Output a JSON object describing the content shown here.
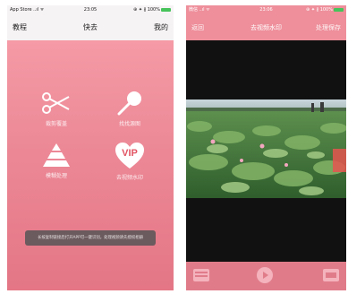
{
  "left": {
    "status": {
      "carrier": "App Store ..ıl ᯤ",
      "time": "23:05",
      "battery": "⊕ ✦ ∦ 100%"
    },
    "nav": {
      "left": "教程",
      "title": "快去",
      "right": "我的"
    },
    "tools": [
      {
        "label": "裁剪覆盖",
        "icon": "scissors-icon"
      },
      {
        "label": "找找源图",
        "icon": "magnifier-icon"
      },
      {
        "label": "模糊处理",
        "icon": "pyramid-icon"
      },
      {
        "label": "去视频水印",
        "icon": "vip-heart-icon"
      }
    ],
    "toast": "长按复制链接后打开APP可一键识别，处理视频请先授权相册"
  },
  "right": {
    "status": {
      "carrier": "微信 ..ıl ᯤ",
      "time": "23:06",
      "battery": "⊕ ✦ ∦ 100%"
    },
    "nav": {
      "left": "返回",
      "title": "去视频水印",
      "right": "处理保存"
    }
  },
  "colors": {
    "pink_top": "#f59aa6",
    "pink_bottom": "#e47685",
    "toast_bg": "#6b5a5e",
    "player_bg": "#111111",
    "controls_bg": "#e07c8a",
    "battery": "#46c35a"
  }
}
